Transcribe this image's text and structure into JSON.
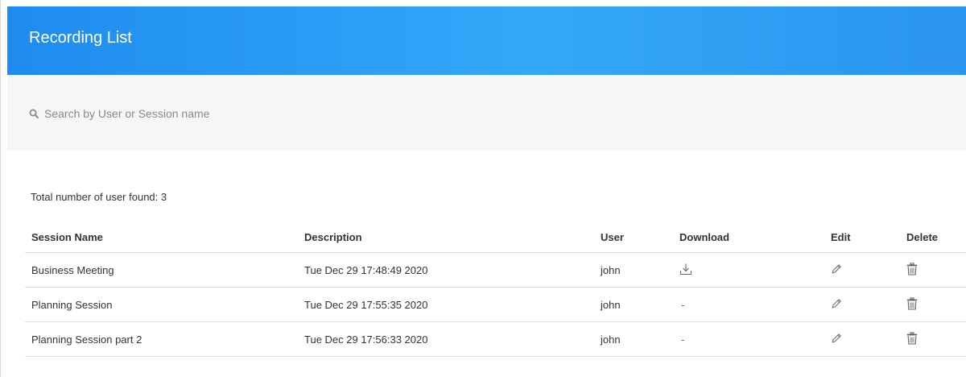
{
  "header": {
    "title": "Recording List"
  },
  "search": {
    "placeholder": "Search by User or Session name",
    "value": ""
  },
  "summary": {
    "total_text": "Total number of user found: 3"
  },
  "table": {
    "columns": [
      "Session Name",
      "Description",
      "User",
      "Download",
      "Edit",
      "Delete"
    ],
    "rows": [
      {
        "session_name": "Business Meeting",
        "description": "Tue Dec 29 17:48:49 2020",
        "user": "john",
        "download": "download-icon"
      },
      {
        "session_name": "Planning Session",
        "description": "Tue Dec 29 17:55:35 2020",
        "user": "john",
        "download": "-"
      },
      {
        "session_name": "Planning Session part 2",
        "description": "Tue Dec 29 17:56:33 2020",
        "user": "john",
        "download": "-"
      }
    ]
  },
  "colors": {
    "header_start": "#1e8cf0",
    "header_mid": "#34a8f9",
    "search_bg": "#f6f6f5",
    "row_border": "#dcdcdc"
  }
}
